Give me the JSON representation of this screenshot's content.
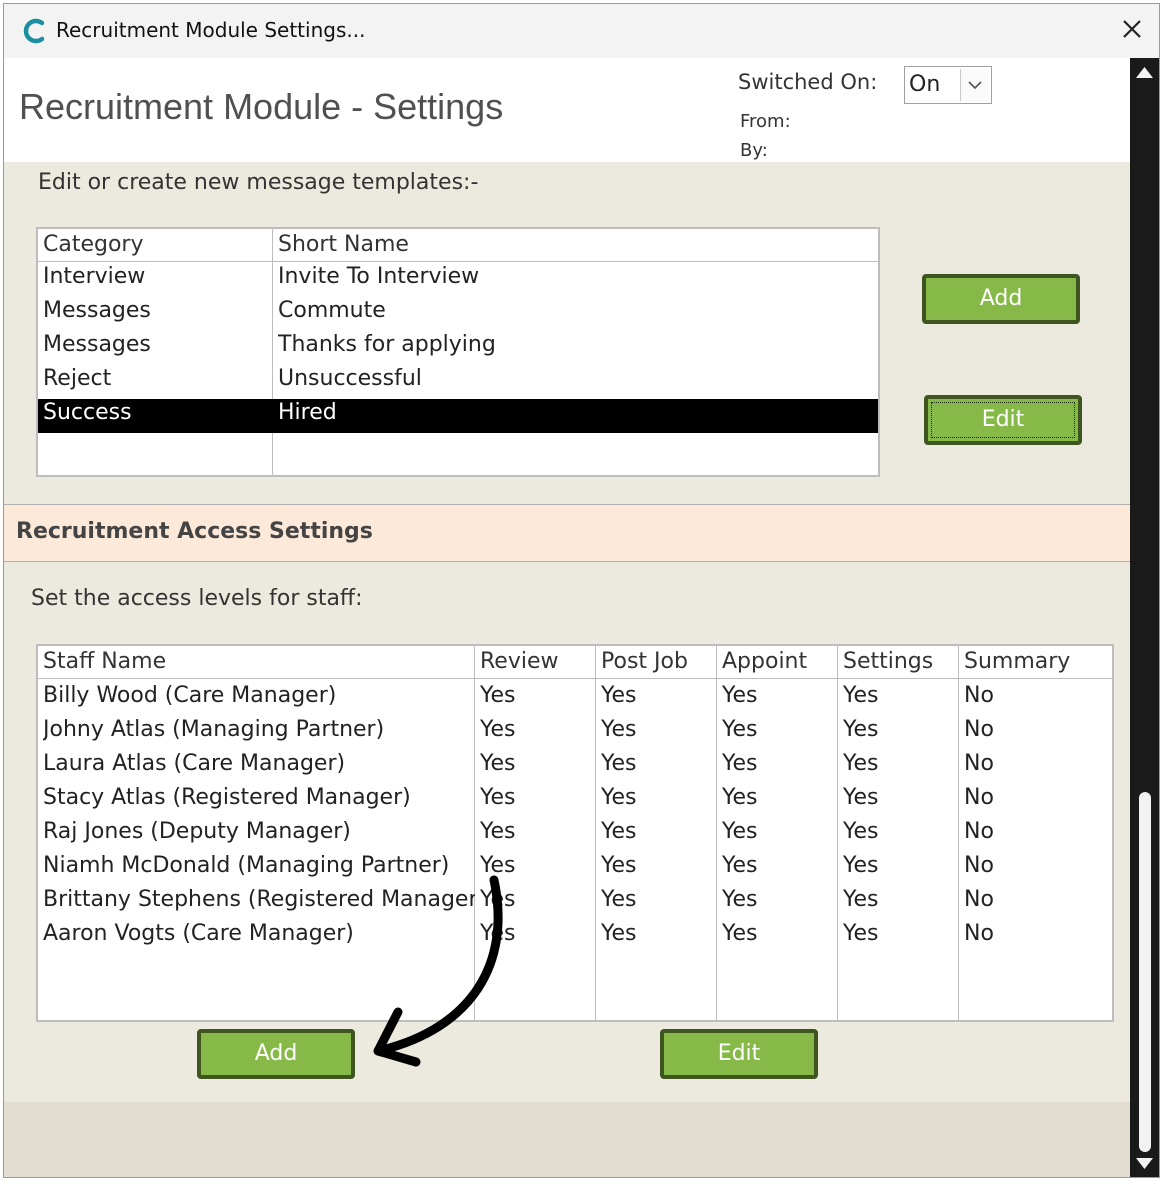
{
  "window": {
    "title": "Recruitment Module Settings...",
    "close_icon": "close-icon",
    "app_icon": "app-c-logo-icon"
  },
  "header": {
    "title": "Recruitment Module - Settings",
    "switched_on_label": "Switched On:",
    "switched_on_value": "On",
    "from_label": "From:",
    "by_label": "By:"
  },
  "templates": {
    "section_title": "Edit or create new message templates:-",
    "columns": [
      "Category",
      "Short Name"
    ],
    "rows": [
      {
        "category": "Interview",
        "short_name": "Invite To Interview"
      },
      {
        "category": "Messages",
        "short_name": "Commute"
      },
      {
        "category": "Messages",
        "short_name": "Thanks for applying"
      },
      {
        "category": "Reject",
        "short_name": "Unsuccessful"
      },
      {
        "category": "Success",
        "short_name": "Hired"
      }
    ],
    "selected_row": 4,
    "add_label": "Add",
    "edit_label": "Edit"
  },
  "access": {
    "band_title": "Recruitment Access Settings",
    "section_title": "Set the access levels for staff:",
    "columns": [
      "Staff Name",
      "Review",
      "Post Job",
      "Appoint",
      "Settings",
      "Summary"
    ],
    "rows": [
      [
        "Billy Wood (Care Manager)",
        "Yes",
        "Yes",
        "Yes",
        "Yes",
        "No"
      ],
      [
        "Johny Atlas (Managing Partner)",
        "Yes",
        "Yes",
        "Yes",
        "Yes",
        "No"
      ],
      [
        "Laura Atlas (Care Manager)",
        "Yes",
        "Yes",
        "Yes",
        "Yes",
        "No"
      ],
      [
        "Stacy Atlas (Registered Manager)",
        "Yes",
        "Yes",
        "Yes",
        "Yes",
        "No"
      ],
      [
        "Raj Jones (Deputy Manager)",
        "Yes",
        "Yes",
        "Yes",
        "Yes",
        "No"
      ],
      [
        "Niamh McDonald (Managing Partner)",
        "Yes",
        "Yes",
        "Yes",
        "Yes",
        "No"
      ],
      [
        "Brittany Stephens (Registered Manager)",
        "Yes",
        "Yes",
        "Yes",
        "Yes",
        "No"
      ],
      [
        "Aaron Vogts (Care Manager)",
        "Yes",
        "Yes",
        "Yes",
        "Yes",
        "No"
      ]
    ],
    "add_label": "Add",
    "edit_label": "Edit"
  },
  "annotation": {
    "icon": "curved-arrow-icon"
  },
  "colors": {
    "button_fill": "#86b948",
    "button_border": "#3e5520",
    "band": "#fde9d9",
    "panel": "#eceadf",
    "selection": "#000000"
  }
}
